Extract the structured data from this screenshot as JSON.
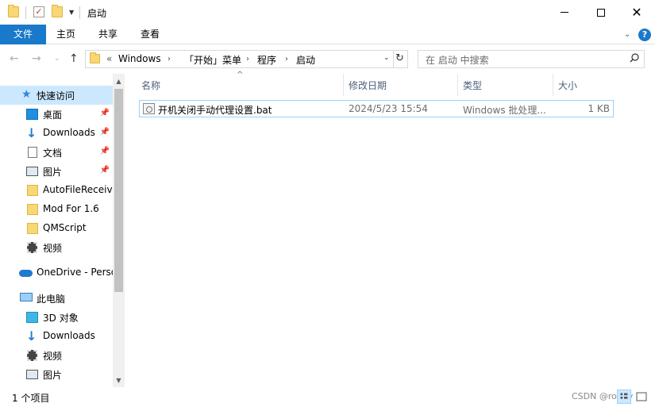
{
  "window": {
    "title": "启动"
  },
  "ribbon": {
    "tabs": [
      "文件",
      "主页",
      "共享",
      "查看"
    ]
  },
  "address": {
    "overflow": "«",
    "crumbs": [
      "Windows",
      "「开始」菜单",
      "程序",
      "启动"
    ],
    "search_placeholder": "在 启动 中搜索"
  },
  "sidebar": {
    "items": [
      {
        "label": "快速访问",
        "icon": "star-icon"
      },
      {
        "label": "桌面",
        "icon": "desktop-icon"
      },
      {
        "label": "Downloads",
        "icon": "download-icon"
      },
      {
        "label": "文档",
        "icon": "document-icon"
      },
      {
        "label": "图片",
        "icon": "picture-icon"
      },
      {
        "label": "AutoFileReceive",
        "icon": "folder-icon"
      },
      {
        "label": "Mod For 1.6",
        "icon": "folder-icon"
      },
      {
        "label": "QMScript",
        "icon": "folder-icon"
      },
      {
        "label": "视频",
        "icon": "video-icon"
      },
      {
        "label": "OneDrive - Personal",
        "icon": "cloud-icon"
      },
      {
        "label": "此电脑",
        "icon": "computer-icon"
      },
      {
        "label": "3D 对象",
        "icon": "cube-icon"
      },
      {
        "label": "Downloads",
        "icon": "download-icon"
      },
      {
        "label": "视频",
        "icon": "video-icon"
      },
      {
        "label": "图片",
        "icon": "picture-icon"
      }
    ]
  },
  "columns": {
    "name": "名称",
    "modified": "修改日期",
    "type": "类型",
    "size": "大小"
  },
  "files": [
    {
      "name": "开机关闭手动代理设置.bat",
      "modified": "2024/5/23 15:54",
      "type": "Windows 批处理...",
      "size": "1 KB"
    }
  ],
  "status": {
    "count": "1 个项目",
    "watermark": "CSDN @roguy"
  },
  "colors": {
    "accent": "#1979ca",
    "selection": "#cce8ff",
    "folder": "#f8d775"
  }
}
